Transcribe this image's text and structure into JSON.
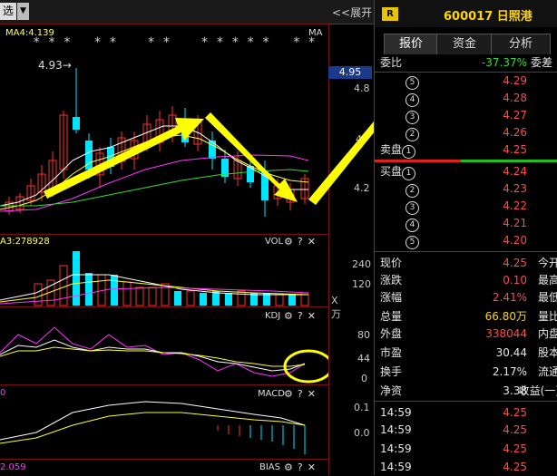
{
  "toolbar": {
    "select_label": "选",
    "expand_label": "<<展开"
  },
  "main_chart": {
    "ma_label": "MA4:4.139",
    "ma_right_label": "MA",
    "stars": "* * *   * *    * *    * * * * *   * *",
    "high_annotation": "4.93",
    "price_ticks": [
      "4.95",
      "4.8",
      "4.",
      "4.2"
    ]
  },
  "volume_panel": {
    "label": "A3:278928",
    "title": "VOL",
    "ticks": [
      "240",
      "120"
    ],
    "unit": "X万"
  },
  "kdj_panel": {
    "label": "KDJ",
    "ticks": [
      "80",
      "44",
      "0"
    ]
  },
  "macd_panel": {
    "left_label": "0",
    "title": "MACD",
    "ticks": [
      "0.1",
      "0.0"
    ]
  },
  "bias_panel": {
    "left_label": "2.059",
    "title": "BIAS"
  },
  "quote": {
    "badge": "R",
    "code_name": "600017 日照港",
    "tabs": [
      "报价",
      "资金",
      "分析"
    ],
    "weibi_label": "委比",
    "weibi_value": "-37.37%",
    "weicha_label": "委差",
    "sell_label": "卖盘",
    "buy_label": "买盘",
    "sell_levels": [
      {
        "n": "5",
        "price": "4.29"
      },
      {
        "n": "4",
        "price": "4.28"
      },
      {
        "n": "3",
        "price": "4.27"
      },
      {
        "n": "2",
        "price": "4.26"
      },
      {
        "n": "1",
        "price": "4.25"
      }
    ],
    "buy_levels": [
      {
        "n": "1",
        "price": "4.24"
      },
      {
        "n": "2",
        "price": "4.23"
      },
      {
        "n": "3",
        "price": "4.22"
      },
      {
        "n": "4",
        "price": "4.21"
      },
      {
        "n": "5",
        "price": "4.20"
      }
    ],
    "stats": [
      {
        "l1": "现价",
        "v1": "4.25",
        "l2": "今开"
      },
      {
        "l1": "涨跌",
        "v1": "0.10",
        "l2": "最高"
      },
      {
        "l1": "涨幅",
        "v1": "2.41%",
        "l2": "最低"
      },
      {
        "l1": "总量",
        "v1": "66.80万",
        "l2": "量比"
      },
      {
        "l1": "外盘",
        "v1": "338044",
        "l2": "内盘"
      },
      {
        "l1": "市盈",
        "v1": "30.44",
        "l2": "股本"
      },
      {
        "l1": "换手",
        "v1": "2.17%",
        "l2": "流通"
      },
      {
        "l1": "净资",
        "v1": "3.38",
        "l2": "收益(一)"
      }
    ],
    "ticks": [
      {
        "time": "14:59",
        "price": "4.25"
      },
      {
        "time": "14:59",
        "price": "4.25"
      },
      {
        "time": "14:59",
        "price": "4.25"
      },
      {
        "time": "14:59",
        "price": "4.25"
      }
    ]
  }
}
